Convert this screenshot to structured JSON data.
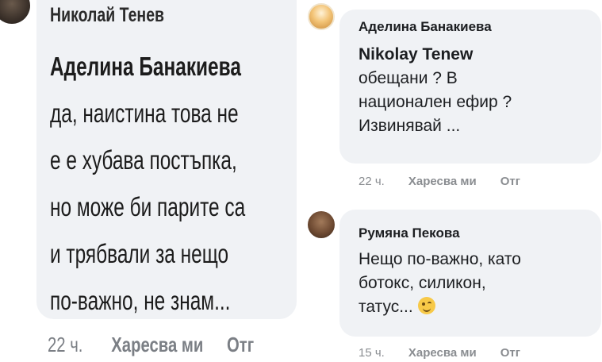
{
  "left_panel": {
    "author": "Николай Тенев",
    "mention": "Аделина Банакиева",
    "lines": [
      "да, наистина това не",
      "е е хубава постъпка,",
      "но може би парите са",
      "и трябвали за нещо",
      "по-важно, не знам..."
    ],
    "time": "22 ч.",
    "like_label": "Харесва ми",
    "reply_label": "Отг"
  },
  "right_panel": {
    "comments": [
      {
        "author": "Аделина Банакиева",
        "mention": "Nikolay Tenew",
        "lines": [
          "обещани ? В",
          "национален ефир ?",
          "Извинявай ..."
        ],
        "time": "22 ч.",
        "like_label": "Харесва ми",
        "reply_label": "Отг"
      },
      {
        "author": "Румяна Пекова",
        "lines": [
          "Нещо по-важно, като",
          "ботокс, силикон,",
          "татус..."
        ],
        "emoji": "wink-emoji",
        "time": "15 ч.",
        "like_label": "Харесва ми",
        "reply_label": "Отг"
      }
    ]
  },
  "colors": {
    "bubble": "#f0f2f5",
    "text": "#1c1e21",
    "meta": "#8a8d91"
  }
}
